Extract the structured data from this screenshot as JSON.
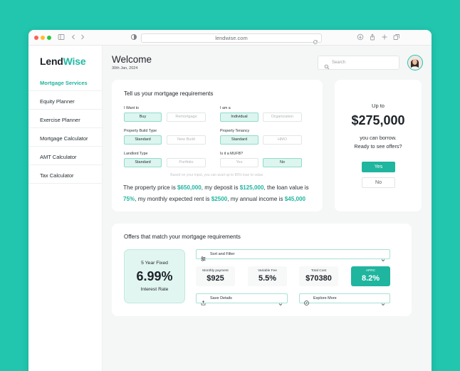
{
  "browser": {
    "url": "lendwise.com"
  },
  "brand": {
    "part1": "Lend",
    "part2": "Wise",
    "accent": "#22b8a3"
  },
  "sidebar": {
    "items": [
      {
        "label": "Mortgage Services",
        "active": true
      },
      {
        "label": "Equity Planner"
      },
      {
        "label": "Exercise Planner"
      },
      {
        "label": "Mortgage Calculator"
      },
      {
        "label": "AMT Calculator"
      },
      {
        "label": "Tax Calculator"
      }
    ]
  },
  "header": {
    "title": "Welcome",
    "date": "30th Jan, 2024",
    "search_placeholder": "Search"
  },
  "requirements": {
    "title": "Tell us your mortgage requirements",
    "groups": [
      {
        "label": "I Want to",
        "options": [
          "Buy",
          "Remortgage"
        ],
        "selected": "Buy"
      },
      {
        "label": "I am a",
        "options": [
          "Individual",
          "Organization"
        ],
        "selected": "Individual"
      },
      {
        "label": "Property Build Type",
        "options": [
          "Standard",
          "New Build"
        ],
        "selected": "Standard"
      },
      {
        "label": "Property Tenancy",
        "options": [
          "Standard",
          "HMO"
        ],
        "selected": "Standard"
      },
      {
        "label": "Landlord Type",
        "options": [
          "Standard",
          "Portfolio"
        ],
        "selected": "Standard"
      },
      {
        "label": "Is it a MUFB?",
        "options": [
          "Yes",
          "No"
        ],
        "selected": "No"
      }
    ],
    "hint": "Based on your input, you can avail up to 85% loan to value.",
    "summary": {
      "t1": "The property price is ",
      "price": "$650,000",
      "t2": ", my deposit is ",
      "deposit": "$125,000",
      "t3": ", the loan value is ",
      "ltv": "75%",
      "t4": ", my monthly expected rent is ",
      "rent": "$2500",
      "t5": ", my annual income is ",
      "income": "$45,000"
    }
  },
  "borrow": {
    "upto": "Up to",
    "amount": "$275,000",
    "line1": "you can borrow.",
    "line2": "Ready to see offers?",
    "yes": "Yes",
    "no": "No"
  },
  "offers": {
    "title": "Offers that match your mortgage requirements",
    "product": {
      "name": "5 Year Fixed",
      "rate": "6.99%",
      "rate_label": "Interest Rate"
    },
    "sort_filter": "Sort and Filter",
    "stats": [
      {
        "label": "Monthly payment",
        "value": "$925"
      },
      {
        "label": "Variable Fee",
        "value": "5.5%"
      },
      {
        "label": "Total Cost",
        "value": "$70380"
      },
      {
        "label": "APRC",
        "value": "8.2%"
      }
    ],
    "save_details": "Save Details",
    "explore_more": "Explore More"
  },
  "icons": [
    "sidebar-icon",
    "back-arrow-icon",
    "forward-arrow-icon",
    "privacy-icon",
    "reload-icon",
    "download-icon",
    "share-icon",
    "new-tab-icon",
    "tabs-icon",
    "search-icon",
    "filter-icon",
    "chevron-down-icon",
    "save-icon",
    "compass-icon"
  ]
}
